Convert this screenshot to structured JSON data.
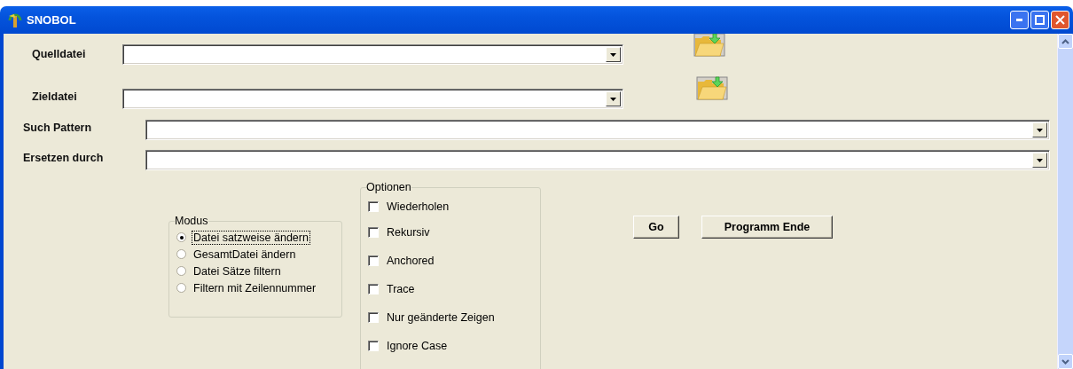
{
  "window": {
    "title": "SNOBOL"
  },
  "file_fields": [
    {
      "label": "Quelldatei"
    },
    {
      "label": "Zieldatei"
    }
  ],
  "pattern_fields": [
    {
      "label": "Such Pattern"
    },
    {
      "label": "Ersetzen durch"
    }
  ],
  "modus": {
    "title": "Modus",
    "options": [
      {
        "label": "Datei satzweise ändern",
        "selected": true
      },
      {
        "label": "GesamtDatei ändern",
        "selected": false
      },
      {
        "label": "Datei Sätze filtern",
        "selected": false
      },
      {
        "label": "Filtern mit Zeilennummer",
        "selected": false
      }
    ]
  },
  "optionen": {
    "title": "Optionen",
    "options": [
      {
        "label": "Wiederholen",
        "checked": false
      },
      {
        "label": "Rekursiv",
        "checked": false
      },
      {
        "label": "Anchored",
        "checked": false
      },
      {
        "label": "Trace",
        "checked": false
      },
      {
        "label": "Nur geänderte Zeigen",
        "checked": false
      },
      {
        "label": "Ignore Case",
        "checked": false
      }
    ]
  },
  "buttons": [
    "Go",
    "Programm Ende"
  ]
}
